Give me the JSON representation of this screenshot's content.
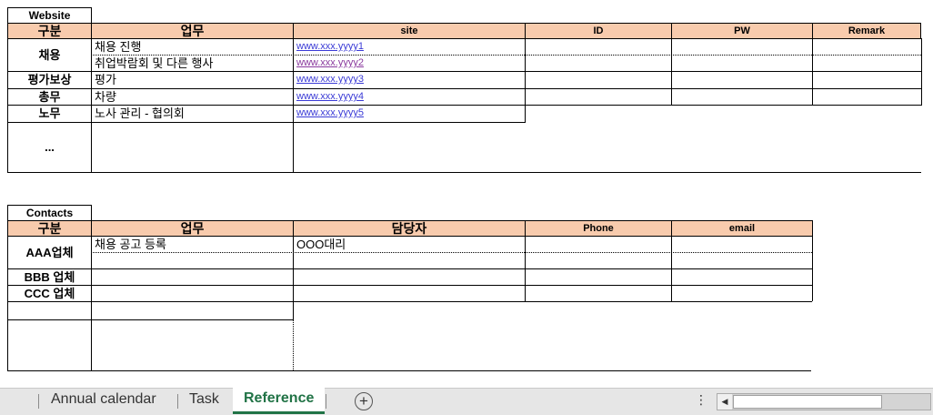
{
  "website": {
    "title": "Website",
    "headers": {
      "category": "구분",
      "task": "업무",
      "site": "site",
      "id": "ID",
      "pw": "PW",
      "remark": "Remark"
    },
    "rows": [
      {
        "category": "채용",
        "tasks": [
          "채용 진행",
          "취업박람회 및 다른 행사"
        ],
        "sites": [
          "www.xxx.yyyy1",
          "www.xxx.yyyy2"
        ]
      },
      {
        "category": "평가보상",
        "tasks": [
          "평가"
        ],
        "sites": [
          "www.xxx.yyyy3"
        ]
      },
      {
        "category": "총무",
        "tasks": [
          "차량"
        ],
        "sites": [
          "www.xxx.yyyy4"
        ]
      },
      {
        "category": "노무",
        "tasks": [
          "노사 관리 - 협의회"
        ],
        "sites": [
          "www.xxx.yyyy5"
        ]
      },
      {
        "category": "...",
        "tasks": [],
        "sites": []
      }
    ]
  },
  "contacts": {
    "title": "Contacts",
    "headers": {
      "category": "구분",
      "task": "업무",
      "person": "담당자",
      "phone": "Phone",
      "email": "email"
    },
    "rows": [
      {
        "category": "AAA업체",
        "task": "채용 공고 등록",
        "person": "OOO대리"
      },
      {
        "category": "BBB 업체",
        "task": "",
        "person": ""
      },
      {
        "category": "CCC 업체",
        "task": "",
        "person": ""
      }
    ]
  },
  "sheet_tabs": {
    "items": [
      "Annual calendar",
      "Task",
      "Reference"
    ],
    "active": "Reference",
    "add_icon": "plus-circle-icon",
    "more_icon": "vertical-ellipsis-icon"
  },
  "colors": {
    "header_fill": "#f8cbad",
    "active_tab": "#217346",
    "link": "#3b3bd6",
    "visited_link": "#8a3a9e"
  }
}
